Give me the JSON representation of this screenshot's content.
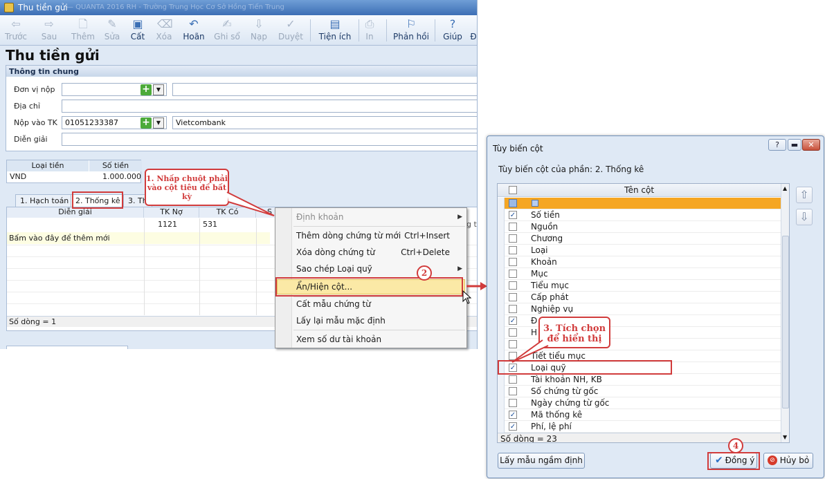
{
  "window": {
    "title": "Thu tiền gửi",
    "subtitle": "— QUANTA 2016 RH - Trường Trung Học Cơ Sở Hồng Tiến Trung"
  },
  "toolbar": {
    "items": [
      {
        "label": "Trước",
        "icon": "arrow-left-icon",
        "glyph": "⇦",
        "enabled": false
      },
      {
        "label": "Sau",
        "icon": "arrow-right-icon",
        "glyph": "⇨",
        "enabled": false
      },
      {
        "label": "Thêm",
        "icon": "add-doc-icon",
        "glyph": "🗋",
        "enabled": false
      },
      {
        "label": "Sửa",
        "icon": "edit-icon",
        "glyph": "✎",
        "enabled": false
      },
      {
        "label": "Cất",
        "icon": "save-icon",
        "glyph": "💾",
        "enabled": true
      },
      {
        "label": "Xóa",
        "icon": "delete-icon",
        "glyph": "⌫",
        "enabled": false
      },
      {
        "label": "Hoãn",
        "icon": "undo-icon",
        "glyph": "↶",
        "enabled": true
      },
      {
        "label": "Ghi sổ",
        "icon": "post-icon",
        "glyph": "✍",
        "enabled": false
      },
      {
        "label": "Nạp",
        "icon": "load-icon",
        "glyph": "⇩",
        "enabled": false
      },
      {
        "label": "Duyệt",
        "icon": "approve-icon",
        "glyph": "✓",
        "enabled": false
      },
      {
        "label": "Tiện ích",
        "icon": "utilities-icon",
        "glyph": "▤",
        "enabled": true
      },
      {
        "label": "In",
        "icon": "print-icon",
        "glyph": "⎙",
        "enabled": false
      },
      {
        "label": "Phản hồi",
        "icon": "feedback-icon",
        "glyph": "📢",
        "enabled": true
      },
      {
        "label": "Giúp",
        "icon": "help-icon",
        "glyph": "?",
        "enabled": true
      }
    ],
    "overflow_label": "Đ"
  },
  "page_title": "Thu tiền gửi",
  "general": {
    "header": "Thông tin chung",
    "payer_label": "Đơn vị nộp",
    "payer_value": "",
    "address_label": "Địa chỉ",
    "address_value": "",
    "account_label": "Nộp vào TK",
    "account_value": "01051233387",
    "bank_value": "Vietcombank",
    "desc_label": "Diễn giải",
    "desc_value": ""
  },
  "currency": {
    "col_type": "Loại tiền",
    "col_amount": "Số tiền",
    "type_value": "VND",
    "amount_value": "1.000.000"
  },
  "tabs": [
    {
      "label": "1. Hạch toán"
    },
    {
      "label": "2. Thống kê"
    },
    {
      "label": "3. Th"
    }
  ],
  "grid": {
    "col_desc": "Diễn giải",
    "col_debit": "TK Nợ",
    "col_credit": "TK Có",
    "col_s": "S",
    "debit_value": "1121",
    "credit_value": "531",
    "add_row_hint": "Bấm vào đây để thêm mới",
    "row_count": "Số dòng = 1",
    "partial_right": "g t"
  },
  "context_menu": {
    "items": [
      {
        "label": "Định khoản",
        "shortcut": "",
        "arrow": true,
        "disabled": true
      },
      {
        "label": "Thêm dòng chứng từ mới",
        "shortcut": "Ctrl+Insert"
      },
      {
        "label": "Xóa dòng chứng từ",
        "shortcut": "Ctrl+Delete"
      },
      {
        "label": "Sao chép Loại quỹ",
        "shortcut": "",
        "arrow": true
      },
      {
        "label": "Ẩn/Hiện cột...",
        "shortcut": ""
      },
      {
        "label": "Cất mẫu chứng từ",
        "shortcut": ""
      },
      {
        "label": "Lấy lại mẫu mặc định",
        "shortcut": ""
      },
      {
        "label": "Xem số dư tài khoản",
        "shortcut": ""
      }
    ]
  },
  "annotations": {
    "step1": "1. Nhấp chuột phải vào cột tiêu đề bất kỳ",
    "step2": "2",
    "step3": "3. Tích chọn để hiển thị",
    "step4": "4"
  },
  "dialog": {
    "title": "Tùy biến cột",
    "help_label": "?",
    "minimize_label": "▬",
    "close_label": "✕",
    "subtitle": "Tùy biến cột của phần: 2. Thống kê",
    "col_header": "Tên cột",
    "rows": [
      {
        "label": "",
        "checked": false
      },
      {
        "label": "Số tiền",
        "checked": true
      },
      {
        "label": "Nguồn",
        "checked": false
      },
      {
        "label": "Chương",
        "checked": false
      },
      {
        "label": "Loại",
        "checked": false
      },
      {
        "label": "Khoản",
        "checked": false
      },
      {
        "label": "Mục",
        "checked": false
      },
      {
        "label": "Tiểu mục",
        "checked": false
      },
      {
        "label": "Cấp phát",
        "checked": false
      },
      {
        "label": "Nghiệp vụ",
        "checked": false
      },
      {
        "label": "Đ",
        "checked": true
      },
      {
        "label": "H",
        "checked": false
      },
      {
        "label": "",
        "checked": false
      },
      {
        "label": "Tiết tiểu mục",
        "checked": false
      },
      {
        "label": "Loại quỹ",
        "checked": true
      },
      {
        "label": "Tài khoản NH, KB",
        "checked": false
      },
      {
        "label": "Số chứng từ gốc",
        "checked": false
      },
      {
        "label": "Ngày chứng từ gốc",
        "checked": false
      },
      {
        "label": "Mã thống kê",
        "checked": true
      },
      {
        "label": "Phí, lệ phí",
        "checked": true
      }
    ],
    "row_count": "Số dòng = 23",
    "default_btn": "Lấy mẫu ngầm định",
    "ok_btn": "Đồng ý",
    "cancel_btn": "Hủy bỏ"
  },
  "colors": {
    "accent": "#3d6fb5",
    "annotation": "#d13b3b",
    "highlight": "#fbe9a6",
    "selected_row": "#f5a623"
  }
}
